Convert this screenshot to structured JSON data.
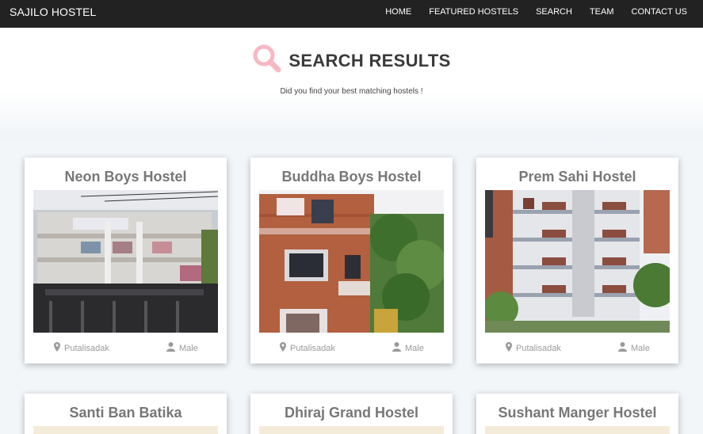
{
  "navbar": {
    "brand": "SAJILO HOSTEL",
    "links": [
      "HOME",
      "FEATURED HOSTELS",
      "SEARCH",
      "TEAM",
      "CONTACT US"
    ]
  },
  "hero": {
    "icon": "search-icon",
    "title": "SEARCH RESULTS",
    "subtitle": "Did you find your best matching hostels !",
    "icon_color": "#f7b8c4"
  },
  "cards": [
    {
      "name": "Neon Boys Hostel",
      "location": "Putalisadak",
      "gender": "Male"
    },
    {
      "name": "Buddha Boys Hostel",
      "location": "Putalisadak",
      "gender": "Male"
    },
    {
      "name": "Prem Sahi Hostel",
      "location": "Putalisadak",
      "gender": "Male"
    },
    {
      "name": "Santi Ban Batika"
    },
    {
      "name": "Dhiraj Grand Hostel"
    },
    {
      "name": "Sushant Manger Hostel"
    }
  ]
}
